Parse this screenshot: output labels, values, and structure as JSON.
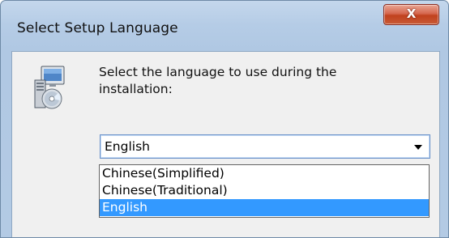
{
  "window": {
    "title": "Select Setup Language",
    "close_label": "X"
  },
  "dialog": {
    "icon": "setup-installer-icon",
    "prompt": "Select the language to use during the\ninstallation:"
  },
  "language_select": {
    "selected_value": "English",
    "options": [
      {
        "label": "Chinese(Simplified)",
        "selected": false
      },
      {
        "label": "Chinese(Traditional)",
        "selected": false
      },
      {
        "label": "English",
        "selected": true
      }
    ]
  },
  "colors": {
    "highlight": "#3399ff",
    "close_button": "#c1411e",
    "frame": "#b5cce6"
  }
}
